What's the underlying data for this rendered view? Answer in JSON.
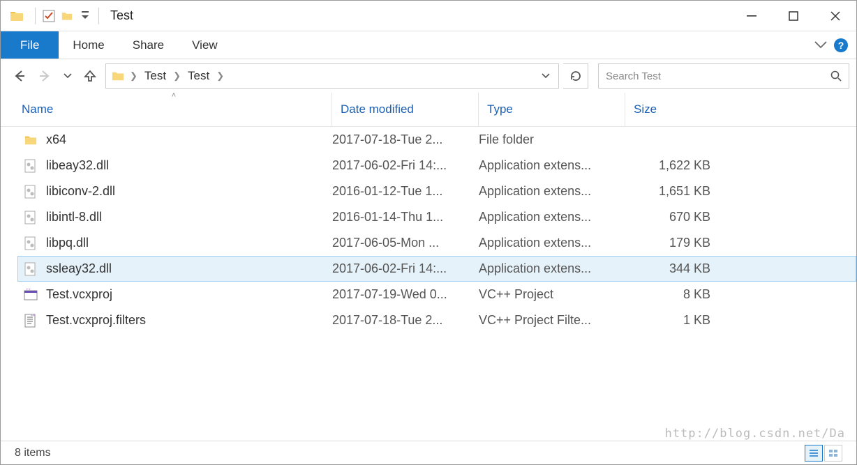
{
  "window": {
    "title": "Test"
  },
  "ribbon": {
    "file": "File",
    "home": "Home",
    "share": "Share",
    "view": "View"
  },
  "breadcrumb": {
    "a": "Test",
    "b": "Test"
  },
  "search": {
    "placeholder": "Search Test"
  },
  "columns": {
    "name": "Name",
    "date": "Date modified",
    "type": "Type",
    "size": "Size"
  },
  "files": [
    {
      "name": "x64",
      "date": "2017-07-18-Tue 2...",
      "type": "File folder",
      "size": "",
      "icon": "folder",
      "selected": false
    },
    {
      "name": "libeay32.dll",
      "date": "2017-06-02-Fri 14:...",
      "type": "Application extens...",
      "size": "1,622 KB",
      "icon": "dll",
      "selected": false
    },
    {
      "name": "libiconv-2.dll",
      "date": "2016-01-12-Tue 1...",
      "type": "Application extens...",
      "size": "1,651 KB",
      "icon": "dll",
      "selected": false
    },
    {
      "name": "libintl-8.dll",
      "date": "2016-01-14-Thu 1...",
      "type": "Application extens...",
      "size": "670 KB",
      "icon": "dll",
      "selected": false
    },
    {
      "name": "libpq.dll",
      "date": "2017-06-05-Mon ...",
      "type": "Application extens...",
      "size": "179 KB",
      "icon": "dll",
      "selected": false
    },
    {
      "name": "ssleay32.dll",
      "date": "2017-06-02-Fri 14:...",
      "type": "Application extens...",
      "size": "344 KB",
      "icon": "dll",
      "selected": true
    },
    {
      "name": "Test.vcxproj",
      "date": "2017-07-19-Wed 0...",
      "type": "VC++ Project",
      "size": "8 KB",
      "icon": "vcproj",
      "selected": false
    },
    {
      "name": "Test.vcxproj.filters",
      "date": "2017-07-18-Tue 2...",
      "type": "VC++ Project Filte...",
      "size": "1 KB",
      "icon": "vcfilter",
      "selected": false
    }
  ],
  "status": {
    "count": "8 items"
  },
  "watermark": "http://blog.csdn.net/Da"
}
